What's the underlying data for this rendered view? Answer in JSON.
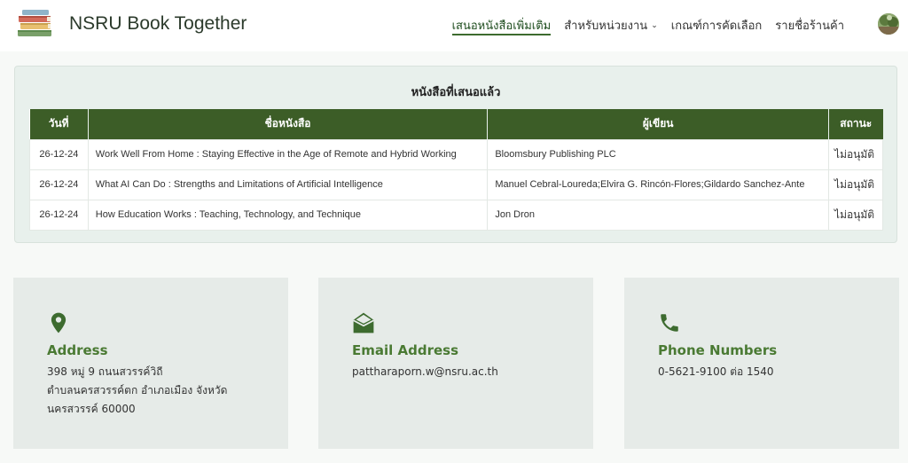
{
  "brand": {
    "name": "NSRU Book Together",
    "logo_icon": "books-stack-icon"
  },
  "nav": {
    "items": [
      {
        "label": "เสนอหนังสือเพิ่มเติม",
        "active": true
      },
      {
        "label": "สำหรับหน่วยงาน",
        "dropdown": true
      },
      {
        "label": "เกณฑ์การคัดเลือก"
      },
      {
        "label": "รายชื่อร้านค้า"
      }
    ],
    "avatar_icon": "user-avatar"
  },
  "books_table": {
    "title": "หนังสือที่เสนอแล้ว",
    "headers": [
      "วันที่",
      "ชื่อหนังสือ",
      "ผู้เขียน",
      "สถานะ"
    ],
    "rows": [
      {
        "date": "26-12-24",
        "title": "Work Well From Home : Staying Effective in the Age of Remote and Hybrid Working",
        "author": "Bloomsbury Publishing PLC",
        "status": "ไม่อนุมัติ"
      },
      {
        "date": "26-12-24",
        "title": "What AI Can Do : Strengths and Limitations of Artificial Intelligence",
        "author": "Manuel Cebral-Loureda;Elvira G. Rincón-Flores;Gildardo Sanchez-Ante",
        "status": "ไม่อนุมัติ"
      },
      {
        "date": "26-12-24",
        "title": "How Education Works : Teaching, Technology, and Technique",
        "author": "Jon Dron",
        "status": "ไม่อนุมัติ"
      }
    ]
  },
  "contact": {
    "address": {
      "icon": "map-pin-icon",
      "title": "Address",
      "lines": [
        "398 หมู่ 9 ถนนสวรรค์วิถี",
        "ตำบลนครสวรรค์ตก อำเภอเมือง จังหวัด",
        "นครสวรรค์ 60000"
      ]
    },
    "email": {
      "icon": "envelope-open-icon",
      "title": "Email Address",
      "lines": [
        "pattharaporn.w@nsru.ac.th"
      ]
    },
    "phone": {
      "icon": "phone-icon",
      "title": "Phone Numbers",
      "lines": [
        "0-5621-9100 ต่อ 1540"
      ]
    }
  },
  "colors": {
    "accent": "#3c5d27",
    "title_green": "#4a7a33",
    "panel_bg": "#e8f0ec",
    "card_bg": "#e6ebe8"
  }
}
